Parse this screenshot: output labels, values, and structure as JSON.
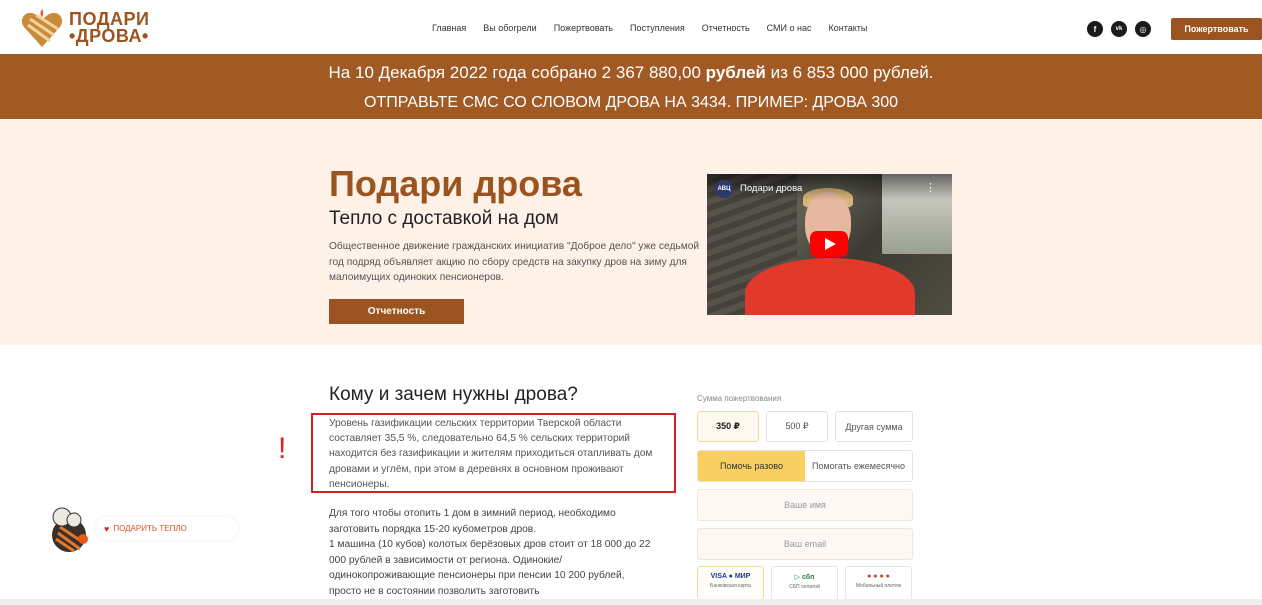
{
  "logo": {
    "line1": "ПОДАРИ",
    "line2": "•ДРОВА•"
  },
  "nav": [
    {
      "label": "Главная"
    },
    {
      "label": "Вы обогрели"
    },
    {
      "label": "Пожертвовать"
    },
    {
      "label": "Поступления"
    },
    {
      "label": "Отчетность"
    },
    {
      "label": "СМИ о нас"
    },
    {
      "label": "Контакты"
    }
  ],
  "socials": [
    {
      "icon": "facebook-icon",
      "glyph": "f"
    },
    {
      "icon": "vk-icon",
      "glyph": "vk"
    },
    {
      "icon": "instagram-icon",
      "glyph": "◎"
    }
  ],
  "header_donate": "Пожертвовать",
  "banner": {
    "line1_prefix": "На 10 Декабря 2022 года собрано 2 367 880,00 ",
    "line1_bold": "рублей",
    "line1_suffix": " из 6 853 000 рублей.",
    "line2": "ОТПРАВЬТЕ СМС СО СЛОВОМ ДРОВА НА 3434. ПРИМЕР: ДРОВА 300"
  },
  "hero": {
    "title": "Подари дрова",
    "subtitle": "Тепло с доставкой на дом",
    "description": "Общественное движение гражданских инициатив \"Доброе дело\" уже седьмой год подряд объявляет акцию по сбору средств на закупку дров на зиму для малоимущих одиноких пенсионеров.",
    "button": "Отчетность"
  },
  "video": {
    "channel": "АВЦ",
    "title": "Подари дрова",
    "menu": "⋮"
  },
  "section": {
    "title": "Кому и зачем нужны дрова?",
    "paragraph1": "Уровень газификации сельских территории Тверской области составляет 35,5 %, следовательно 64,5 % сельских территорий находится без газификации и жителям приходиться отапливать дом дровами и углём, при этом в деревнях в основном проживают пенсионеры.",
    "paragraph2": "Для того чтобы отопить 1 дом в зимний период, необходимо заготовить порядка 15-20 кубометров дров.\n1 машина (10 кубов) колотых берёзовых дров стоит от 18 000 до 22 000 рублей в зависимости от региона. Одинокие/ одинокопроживающие пенсионеры при пенсии 10 200 рублей, просто не в состоянии позволить заготовить",
    "annotation_mark": "!"
  },
  "widget": {
    "heart": "♥",
    "label": "ПОДАРИТЬ ТЕПЛО"
  },
  "form": {
    "label": "Сумма пожертвования",
    "amounts": [
      "350 ₽",
      "500 ₽",
      "Другая сумма"
    ],
    "selected_amount": "350 ₽",
    "frequency": [
      "Помочь разово",
      "Помогать ежемесячно"
    ],
    "selected_frequency": "Помочь разово",
    "name_placeholder": "Ваше имя",
    "email_placeholder": "Ваш email",
    "payment_methods": [
      {
        "title": "VISA ● МИР",
        "subtitle": "Банковская карта"
      },
      {
        "title": "▷ сбп",
        "subtitle": "СБП оплатой"
      },
      {
        "title": "● ● ● ●",
        "subtitle": "Мобильный платеж"
      }
    ]
  },
  "colors": {
    "brand": "#9b5420",
    "banner": "#a15a24",
    "hero_bg": "#fdf1e8",
    "accent_yellow": "#f7cf62",
    "annotation_red": "#d62020"
  }
}
